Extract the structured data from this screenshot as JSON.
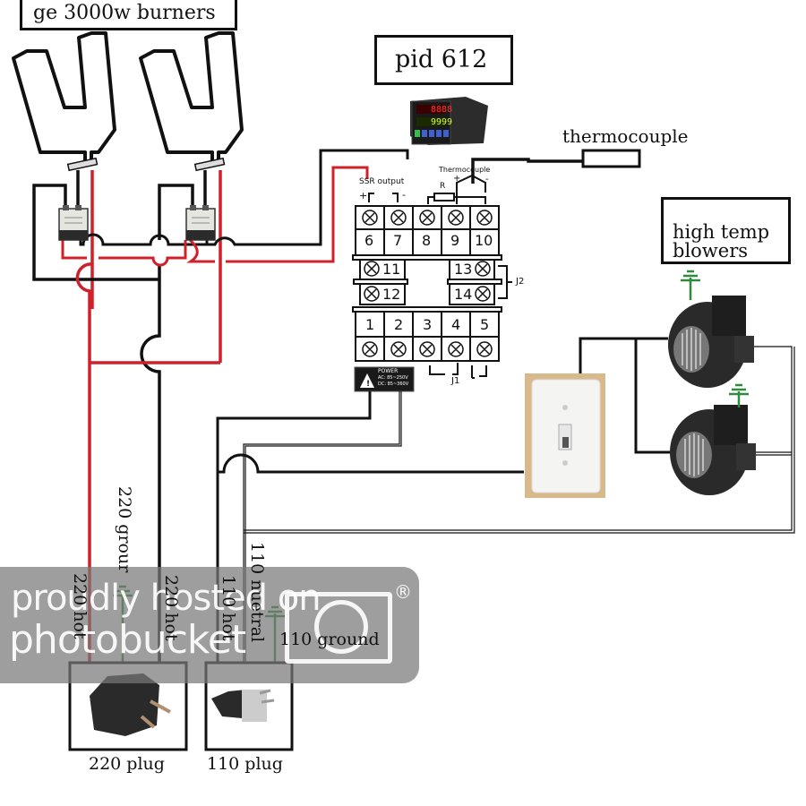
{
  "title_labels": {
    "burners": "ge 3000w burners",
    "pid": "pid 612",
    "thermocouple": "thermocouple",
    "blowers_line1": "high temp",
    "blowers_line2": "blowers"
  },
  "pid_controller": {
    "display_top": "8888",
    "display_bottom": "9999",
    "ssr_output_label": "SSR output",
    "thermocouple_label": "Thermocouple",
    "resistor_label": "R",
    "plus": "+",
    "minus": "-",
    "top_terminals": [
      "6",
      "7",
      "8",
      "9",
      "10"
    ],
    "middle_left_terminals": [
      "11",
      "12"
    ],
    "middle_right_terminals": [
      "13",
      "14"
    ],
    "bottom_terminals": [
      "1",
      "2",
      "3",
      "4",
      "5"
    ],
    "j1_label": "J1",
    "j2_label": "J2",
    "power_label": "POWER",
    "power_ac": "AC: 85~250V",
    "power_dc": "DC: 85~360V"
  },
  "wire_labels": {
    "hot_220_a": "220 hot",
    "ground_220": "220 grour",
    "hot_220_b": "220 hot",
    "hot_110": "110 hot",
    "neutral_110": "110 nuetral",
    "ground_110": "110 ground"
  },
  "plugs": {
    "plug_220": "220 plug",
    "plug_110": "110 plug"
  },
  "watermark": {
    "line1": "proudly hosted on",
    "line2": "photobucket",
    "registered": "®"
  },
  "colors": {
    "wire_black": "#111111",
    "wire_red": "#d0202a",
    "ground_green": "#2e8b3e",
    "switch_frame": "#d8b98c",
    "switch_plate": "#f4f4f2",
    "blower_body": "#2a2a2a"
  }
}
